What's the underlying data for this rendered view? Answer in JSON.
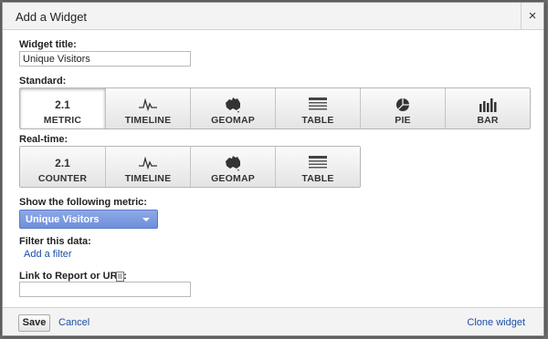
{
  "dialog": {
    "title": "Add a Widget",
    "close_icon": "close-icon",
    "close_glyph": "×"
  },
  "widget_title": {
    "label": "Widget title:",
    "value": "Unique Visitors"
  },
  "standard": {
    "label": "Standard:",
    "buttons": [
      {
        "label": "METRIC",
        "number": "2.1",
        "icon": "metric-icon",
        "selected": true
      },
      {
        "label": "TIMELINE",
        "icon": "timeline-icon"
      },
      {
        "label": "GEOMAP",
        "icon": "geomap-icon"
      },
      {
        "label": "TABLE",
        "icon": "table-icon"
      },
      {
        "label": "PIE",
        "icon": "pie-icon"
      },
      {
        "label": "BAR",
        "icon": "bar-icon"
      }
    ]
  },
  "realtime": {
    "label": "Real-time:",
    "buttons": [
      {
        "label": "COUNTER",
        "number": "2.1",
        "icon": "counter-icon"
      },
      {
        "label": "TIMELINE",
        "icon": "timeline-icon"
      },
      {
        "label": "GEOMAP",
        "icon": "geomap-icon"
      },
      {
        "label": "TABLE",
        "icon": "table-icon"
      }
    ]
  },
  "metric": {
    "label": "Show the following metric:",
    "selected": "Unique Visitors",
    "color": "#7b99e0"
  },
  "filter": {
    "label": "Filter this data:",
    "add_link": "Add a filter"
  },
  "link": {
    "label": "Link to Report or URL:",
    "icon": "document-icon",
    "value": ""
  },
  "footer": {
    "save_label": "Save",
    "cancel_label": "Cancel",
    "clone_label": "Clone widget"
  },
  "colors": {
    "link": "#1a4ea8",
    "overlay": "#6f6f6f"
  }
}
